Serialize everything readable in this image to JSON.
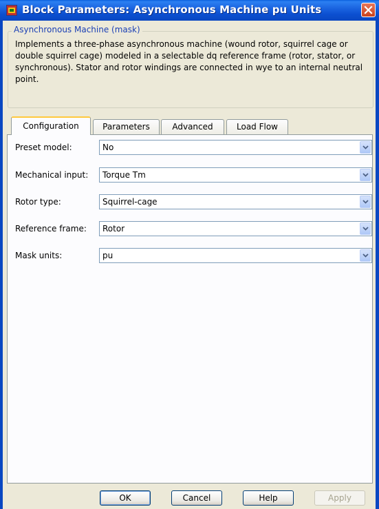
{
  "window": {
    "title": "Block Parameters: Asynchronous Machine pu Units",
    "accent": "#0a47c2"
  },
  "group": {
    "title": "Asynchronous Machine (mask)",
    "description": "Implements a three-phase asynchronous machine (wound rotor, squirrel cage or double squirrel cage) modeled in a selectable dq reference frame (rotor, stator, or synchronous). Stator and rotor windings are connected in wye to an internal neutral point."
  },
  "tabs": [
    {
      "label": "Configuration",
      "active": true
    },
    {
      "label": "Parameters",
      "active": false
    },
    {
      "label": "Advanced",
      "active": false
    },
    {
      "label": "Load Flow",
      "active": false
    }
  ],
  "fields": [
    {
      "label": "Preset model:",
      "value": "No"
    },
    {
      "label": "Mechanical input:",
      "value": "Torque Tm"
    },
    {
      "label": "Rotor type:",
      "value": "Squirrel-cage"
    },
    {
      "label": "Reference frame:",
      "value": "Rotor"
    },
    {
      "label": "Mask units:",
      "value": "pu"
    }
  ],
  "buttons": {
    "ok": "OK",
    "cancel": "Cancel",
    "help": "Help",
    "apply": "Apply"
  },
  "icons": {
    "app": "simulink-block-icon",
    "close": "close-icon",
    "dropdown": "chevron-down-icon"
  }
}
